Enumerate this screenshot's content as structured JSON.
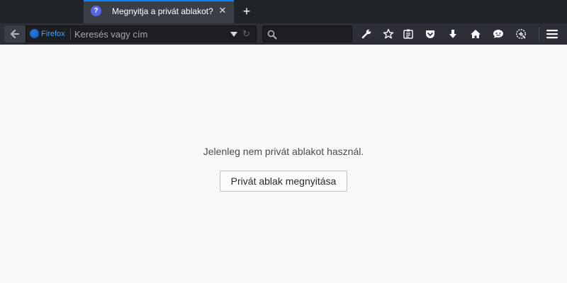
{
  "tab": {
    "favicon_glyph": "?",
    "title": "Megnyitja a privát ablakot?",
    "close_glyph": "✕"
  },
  "new_tab_glyph": "+",
  "urlbar": {
    "identity_label": "Firefox",
    "placeholder": "Keresés vagy cím",
    "reload_glyph": "↻"
  },
  "toolbar_icons": [
    "back-arrow-icon",
    "firefox-logo-icon",
    "dropdown-arrow-icon",
    "reload-icon",
    "search-icon",
    "wrench-icon",
    "star-icon",
    "reading-list-icon",
    "pocket-icon",
    "download-arrow-icon",
    "home-icon",
    "chat-icon",
    "screenshot-icon",
    "hamburger-menu-icon"
  ],
  "colors": {
    "accent": "#0a84ff",
    "tabstrip": "#202328",
    "navbar": "#2c3036",
    "content_bg": "#f9f9fa"
  },
  "content": {
    "message": "Jelenleg nem privát ablakot használ.",
    "button_label": "Privát ablak megnyitása"
  }
}
